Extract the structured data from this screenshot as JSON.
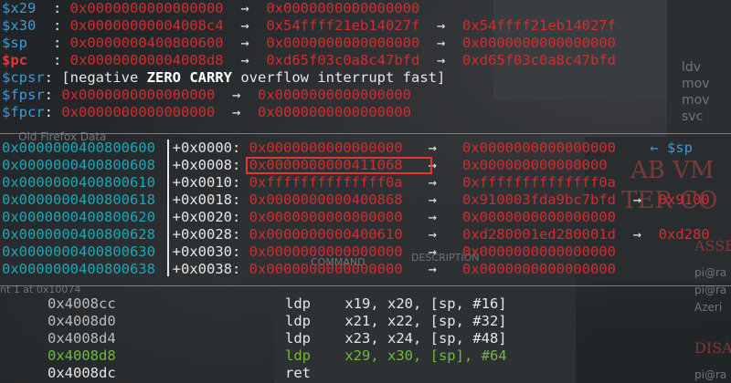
{
  "registers": [
    {
      "name": "$x29",
      "chain": [
        "0x0000000000000000",
        "0x0000000000000000"
      ]
    },
    {
      "name": "$x30",
      "chain": [
        "0x00000000004008c4",
        "0x54ffff21eb14027f",
        "0x54ffff21eb14027f"
      ]
    },
    {
      "name": "$sp",
      "chain": [
        "0x0000000400800600",
        "0x0000000000000000",
        "0x0000000000000000"
      ]
    },
    {
      "name": "$pc",
      "chain": [
        "0x00000000004008d8",
        "0xd65f03c0a8c47bfd",
        "0xd65f03c0a8c47bfd"
      ]
    }
  ],
  "cpsr": {
    "name": "$cpsr",
    "open": "[negative ",
    "zero": "ZERO",
    "space1": " ",
    "carry": "CARRY",
    "rest": " overflow interrupt fast]"
  },
  "fpsr": {
    "name": "$fpsr",
    "chain": [
      "0x0000000000000000",
      "0x0000000000000000"
    ]
  },
  "fpcr": {
    "name": "$fpcr",
    "chain": [
      "0x0000000000000000",
      "0x0000000000000000"
    ]
  },
  "stack": [
    {
      "addr": "0x0000000400800600",
      "offset": "+0x0000:",
      "values": [
        "0x0000000000000000",
        "0x0000000000000000"
      ],
      "tag": "← $sp"
    },
    {
      "addr": "0x0000000400800608",
      "offset": "+0x0008:",
      "values": [
        "0x0000000000411068",
        "0x000000000000000"
      ],
      "tag": ""
    },
    {
      "addr": "0x0000000400800610",
      "offset": "+0x0010:",
      "values": [
        "0xffffffffffffff0a",
        "0xffffffffffffff0a"
      ],
      "tag": ""
    },
    {
      "addr": "0x0000000400800618",
      "offset": "+0x0018:",
      "values": [
        "0x0000000000400868",
        "0x910003fda9bc7bfd",
        "0x9100"
      ],
      "tag": ""
    },
    {
      "addr": "0x0000000400800620",
      "offset": "+0x0020:",
      "values": [
        "0x0000000000000000",
        "0x0000000000000000"
      ],
      "tag": ""
    },
    {
      "addr": "0x0000000400800628",
      "offset": "+0x0028:",
      "values": [
        "0x0000000000400610",
        "0xd280001ed280001d",
        "0xd280"
      ],
      "tag": ""
    },
    {
      "addr": "0x0000000400800630",
      "offset": "+0x0030:",
      "values": [
        "0x0000000000000000",
        "0x0000000000000000"
      ],
      "tag": ""
    },
    {
      "addr": "0x0000000400800638",
      "offset": "+0x0038:",
      "values": [
        "0x0000000000000000",
        "0x0000000000000000"
      ],
      "tag": ""
    }
  ],
  "arrow": "→",
  "disasm": [
    {
      "addr": "0x4008cc",
      "text": "ldp    x19, x20, [sp, #16]",
      "current": false
    },
    {
      "addr": "0x4008d0",
      "text": "ldp    x21, x22, [sp, #32]",
      "current": false
    },
    {
      "addr": "0x4008d4",
      "text": "ldp    x23, x24, [sp, #48]",
      "current": false
    },
    {
      "addr": "0x4008d8",
      "text": "ldp    x29, x30, [sp], #64",
      "current": true
    },
    {
      "addr": "0x4008dc",
      "text": "ret",
      "current": false
    }
  ],
  "background_text": {
    "old_firefox": "Old Firefox Data",
    "breakpoint_note": "nt 1 at 0x10074",
    "command_header": "COMMAND",
    "description_header": "DESCRIPTION",
    "right_mono": [
      "ldv",
      "mov",
      "mov",
      "svc"
    ],
    "right_user": [
      "pi@ra",
      "pi@ra",
      "Azeri",
      "pi@ra"
    ],
    "red_title_1": "AB VM",
    "red_title_2": "TER CO",
    "red_small_1": "ASSE",
    "red_small_2": "DISA"
  }
}
